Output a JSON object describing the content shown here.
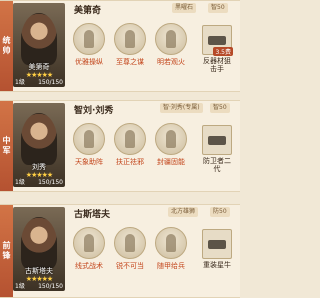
{
  "cards": [
    {
      "side_label": "统帅",
      "hero_name": "美第奇",
      "tags": [
        "黑曜石",
        "智50"
      ],
      "portrait_name": "美第奇",
      "level": "1级",
      "troops": "150/150",
      "skills": [
        "优雅操纵",
        "至尊之谋",
        "明若观火"
      ],
      "unit": {
        "name": "反器材狙击手",
        "badge": "3.5费"
      }
    },
    {
      "side_label": "中军",
      "hero_name": "智刘·刘秀",
      "tags": [
        "智·刘秀(专属)",
        "智50"
      ],
      "portrait_name": "刘秀",
      "level": "1级",
      "troops": "150/150",
      "skills": [
        "天象助阵",
        "扶正祛邪",
        "封疆固能"
      ],
      "unit": {
        "name": "防卫者二代",
        "badge": ""
      }
    },
    {
      "side_label": "前锋",
      "hero_name": "古斯塔夫",
      "tags": [
        "北方雄狮",
        "防50"
      ],
      "portrait_name": "古斯塔夫",
      "level": "1级",
      "troops": "150/150",
      "skills": [
        "线式战术",
        "锐不可当",
        "随甲给兵"
      ],
      "unit": {
        "name": "重装星牛",
        "badge": ""
      }
    }
  ],
  "portrait_stars": "★★★★★"
}
